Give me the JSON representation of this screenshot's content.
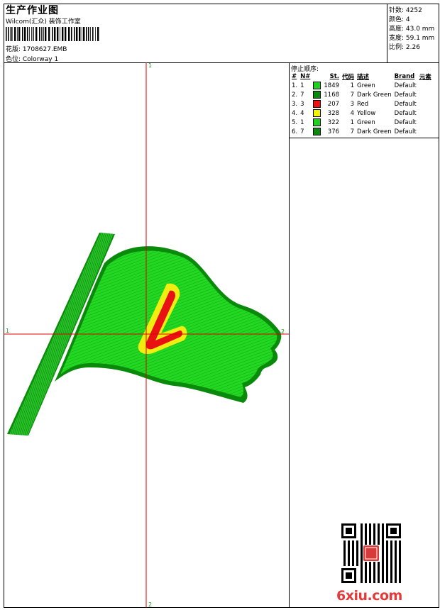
{
  "header": {
    "title": "生产作业图",
    "company": "Wilcom(汇众) 装饰工作室",
    "design": "花版: 1708627.EMB",
    "colorway": "色位: Colorway 1"
  },
  "stats": {
    "stitches": "针数: 4252",
    "colors": "颜色: 4",
    "height": "高度: 43.0 mm",
    "width": "宽度: 59.1 mm",
    "ratio": "比例: 2.26"
  },
  "stop_sequence": {
    "title": "停止顺序:",
    "headers": [
      "#",
      "N#",
      "St.",
      "代码",
      "描述",
      "Brand",
      "元素"
    ],
    "rows": [
      {
        "idx": "1.",
        "n": "1",
        "color": "#1fd11f",
        "st": "1849",
        "code": "1",
        "desc": "Green",
        "brand": "Default"
      },
      {
        "idx": "2.",
        "n": "7",
        "color": "#0a8a0a",
        "st": "1168",
        "code": "7",
        "desc": "Dark Green",
        "brand": "Default"
      },
      {
        "idx": "3.",
        "n": "3",
        "color": "#ee1111",
        "st": "207",
        "code": "3",
        "desc": "Red",
        "brand": "Default"
      },
      {
        "idx": "4.",
        "n": "4",
        "color": "#f4f400",
        "st": "328",
        "code": "4",
        "desc": "Yellow",
        "brand": "Default"
      },
      {
        "idx": "5.",
        "n": "1",
        "color": "#1fd11f",
        "st": "322",
        "code": "1",
        "desc": "Green",
        "brand": "Default"
      },
      {
        "idx": "6.",
        "n": "7",
        "color": "#0a8a0a",
        "st": "376",
        "code": "7",
        "desc": "Dark Green",
        "brand": "Default"
      }
    ]
  },
  "axes": {
    "top": "1",
    "bottom": "2",
    "left": "1",
    "right": "2"
  },
  "watermark": "6xiu.com",
  "qr_stamp": "汉字印章"
}
